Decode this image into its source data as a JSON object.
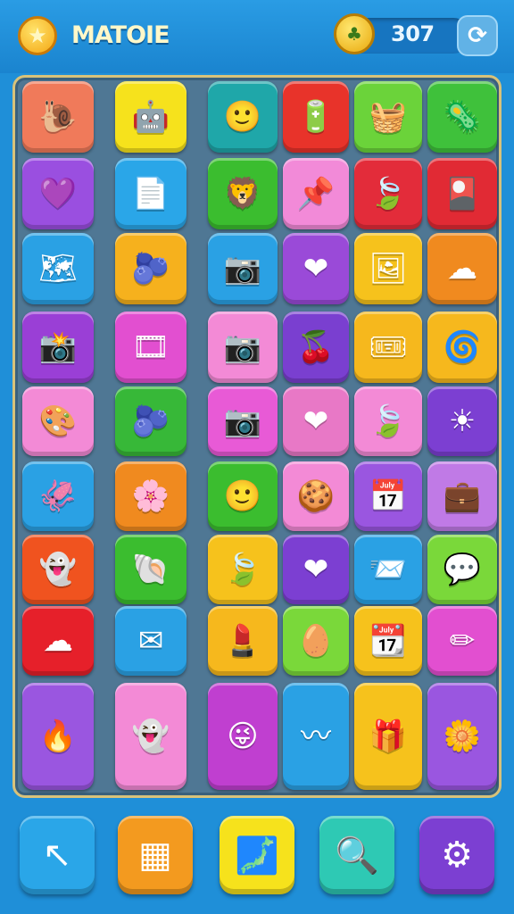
{
  "header": {
    "title": "MATOIE",
    "score": "307",
    "logo_icon": "star-icon",
    "coin_icon": "coin-icon",
    "refresh_icon": "refresh-icon"
  },
  "board": {
    "tiles": [
      {
        "icon": "snail-icon",
        "glyph": "🐌",
        "color": "#f07a5a"
      },
      {
        "icon": "robot-face-icon",
        "glyph": "🤖",
        "color": "#f6e21c"
      },
      {
        "icon": "smiley-icon",
        "glyph": "🙂",
        "color": "#1fa7a9"
      },
      {
        "icon": "battery-icon",
        "glyph": "🔋",
        "color": "#e8332a"
      },
      {
        "icon": "washing-machine-icon",
        "glyph": "🧺",
        "color": "#6bd33a"
      },
      {
        "icon": "virus-icon",
        "glyph": "🦠",
        "color": "#3fc13b"
      },
      {
        "icon": "heart-icon",
        "glyph": "💜",
        "color": "#9a4fe0"
      },
      {
        "icon": "paper-icon",
        "glyph": "📄",
        "color": "#2aa6e8"
      },
      {
        "icon": "lion-face-icon",
        "glyph": "🦁",
        "color": "#3bbd2f"
      },
      {
        "icon": "pin-icon",
        "glyph": "📌",
        "color": "#f28ad8"
      },
      {
        "icon": "leaf-icon",
        "glyph": "🍃",
        "color": "#e32c3a"
      },
      {
        "icon": "card-icon",
        "glyph": "🎴",
        "color": "#e12a34"
      },
      {
        "icon": "map-icon",
        "glyph": "🗺",
        "color": "#2aa1e4"
      },
      {
        "icon": "blob-icon",
        "glyph": "🫐",
        "color": "#f6b11d"
      },
      {
        "icon": "camera-icon",
        "glyph": "📷",
        "color": "#2aa1e4"
      },
      {
        "icon": "heart-icon",
        "glyph": "❤",
        "color": "#9a4ad8"
      },
      {
        "icon": "picture-frame-icon",
        "glyph": "🖼",
        "color": "#f6c21c"
      },
      {
        "icon": "cloud-icon",
        "glyph": "☁",
        "color": "#f08a1f"
      },
      {
        "icon": "camera-icon",
        "glyph": "📸",
        "color": "#9a3fd6"
      },
      {
        "icon": "camera-lens-icon",
        "glyph": "🎞",
        "color": "#e24fd0"
      },
      {
        "icon": "camera-icon",
        "glyph": "📷",
        "color": "#f38ad6"
      },
      {
        "icon": "cherry-icon",
        "glyph": "🍒",
        "color": "#7a3fd0"
      },
      {
        "icon": "ticket-icon",
        "glyph": "🎟",
        "color": "#f6b81d"
      },
      {
        "icon": "spiral-icon",
        "glyph": "🌀",
        "color": "#f6b81d"
      },
      {
        "icon": "color-wheel-icon",
        "glyph": "🎨",
        "color": "#f38ad6"
      },
      {
        "icon": "blob-icon",
        "glyph": "🫐",
        "color": "#37b838"
      },
      {
        "icon": "camera-icon",
        "glyph": "📷",
        "color": "#e85ad6"
      },
      {
        "icon": "heart-icon",
        "glyph": "❤",
        "color": "#e878c6"
      },
      {
        "icon": "leaf-icon",
        "glyph": "🍃",
        "color": "#f38ad6"
      },
      {
        "icon": "sun-icon",
        "glyph": "☀",
        "color": "#7c3fd2"
      },
      {
        "icon": "squid-icon",
        "glyph": "🦑",
        "color": "#2aa1e4"
      },
      {
        "icon": "flower-icon",
        "glyph": "🌸",
        "color": "#f08a1f"
      },
      {
        "icon": "smiley-icon",
        "glyph": "🙂",
        "color": "#3bbd2f"
      },
      {
        "icon": "cookie-icon",
        "glyph": "🍪",
        "color": "#f38ad6"
      },
      {
        "icon": "calendar-icon",
        "glyph": "📅",
        "color": "#9a56e0"
      },
      {
        "icon": "briefcase-icon",
        "glyph": "💼",
        "color": "#c07ae6"
      },
      {
        "icon": "ghost-face-icon",
        "glyph": "👻",
        "color": "#f0531f"
      },
      {
        "icon": "spiral-shell-icon",
        "glyph": "🐚",
        "color": "#3bbd2f"
      },
      {
        "icon": "leaf-icon",
        "glyph": "🍃",
        "color": "#f6c21c"
      },
      {
        "icon": "heart-icon",
        "glyph": "❤",
        "color": "#7c3fd2"
      },
      {
        "icon": "envelope-star-icon",
        "glyph": "📨",
        "color": "#2aa1e4"
      },
      {
        "icon": "chat-bubble-icon",
        "glyph": "💬",
        "color": "#7ad83a"
      },
      {
        "icon": "cloud-icon",
        "glyph": "☁",
        "color": "#e6202a"
      },
      {
        "icon": "envelope-icon",
        "glyph": "✉",
        "color": "#2aa1e4"
      },
      {
        "icon": "lipstick-icon",
        "glyph": "💄",
        "color": "#f6b81d"
      },
      {
        "icon": "egg-icon",
        "glyph": "🥚",
        "color": "#7ad83a"
      },
      {
        "icon": "calendar-icon",
        "glyph": "📆",
        "color": "#f6c21c"
      },
      {
        "icon": "pencil-icon",
        "glyph": "✏",
        "color": "#e24fd0"
      },
      {
        "icon": "flame-leaf-icon",
        "glyph": "🔥",
        "color": "#9a56e0"
      },
      {
        "icon": "ghost-icon",
        "glyph": "👻",
        "color": "#f38ad6"
      },
      {
        "icon": "face-card-icon",
        "glyph": "😜",
        "color": "#c03fd0"
      },
      {
        "icon": "hook-icon",
        "glyph": "〰",
        "color": "#2aa1e4"
      },
      {
        "icon": "box-icon",
        "glyph": "🎁",
        "color": "#f6c21c"
      },
      {
        "icon": "flower-icon",
        "glyph": "🌼",
        "color": "#9a56e0"
      }
    ]
  },
  "toolbar": {
    "buttons": [
      {
        "name": "pointer-tool-button",
        "icon": "arrow-cursor-icon",
        "glyph": "↖",
        "color": "#2aa6e8"
      },
      {
        "name": "inventory-button",
        "icon": "dashboard-icon",
        "glyph": "▦",
        "color": "#f39a1f"
      },
      {
        "name": "map-button",
        "icon": "map-blob-icon",
        "glyph": "🗾",
        "color": "#f6e21c"
      },
      {
        "name": "search-button",
        "icon": "search-icon",
        "glyph": "🔍",
        "color": "#2ec9b4"
      },
      {
        "name": "settings-button",
        "icon": "gear-icon",
        "glyph": "⚙",
        "color": "#7c3fd2"
      }
    ]
  }
}
